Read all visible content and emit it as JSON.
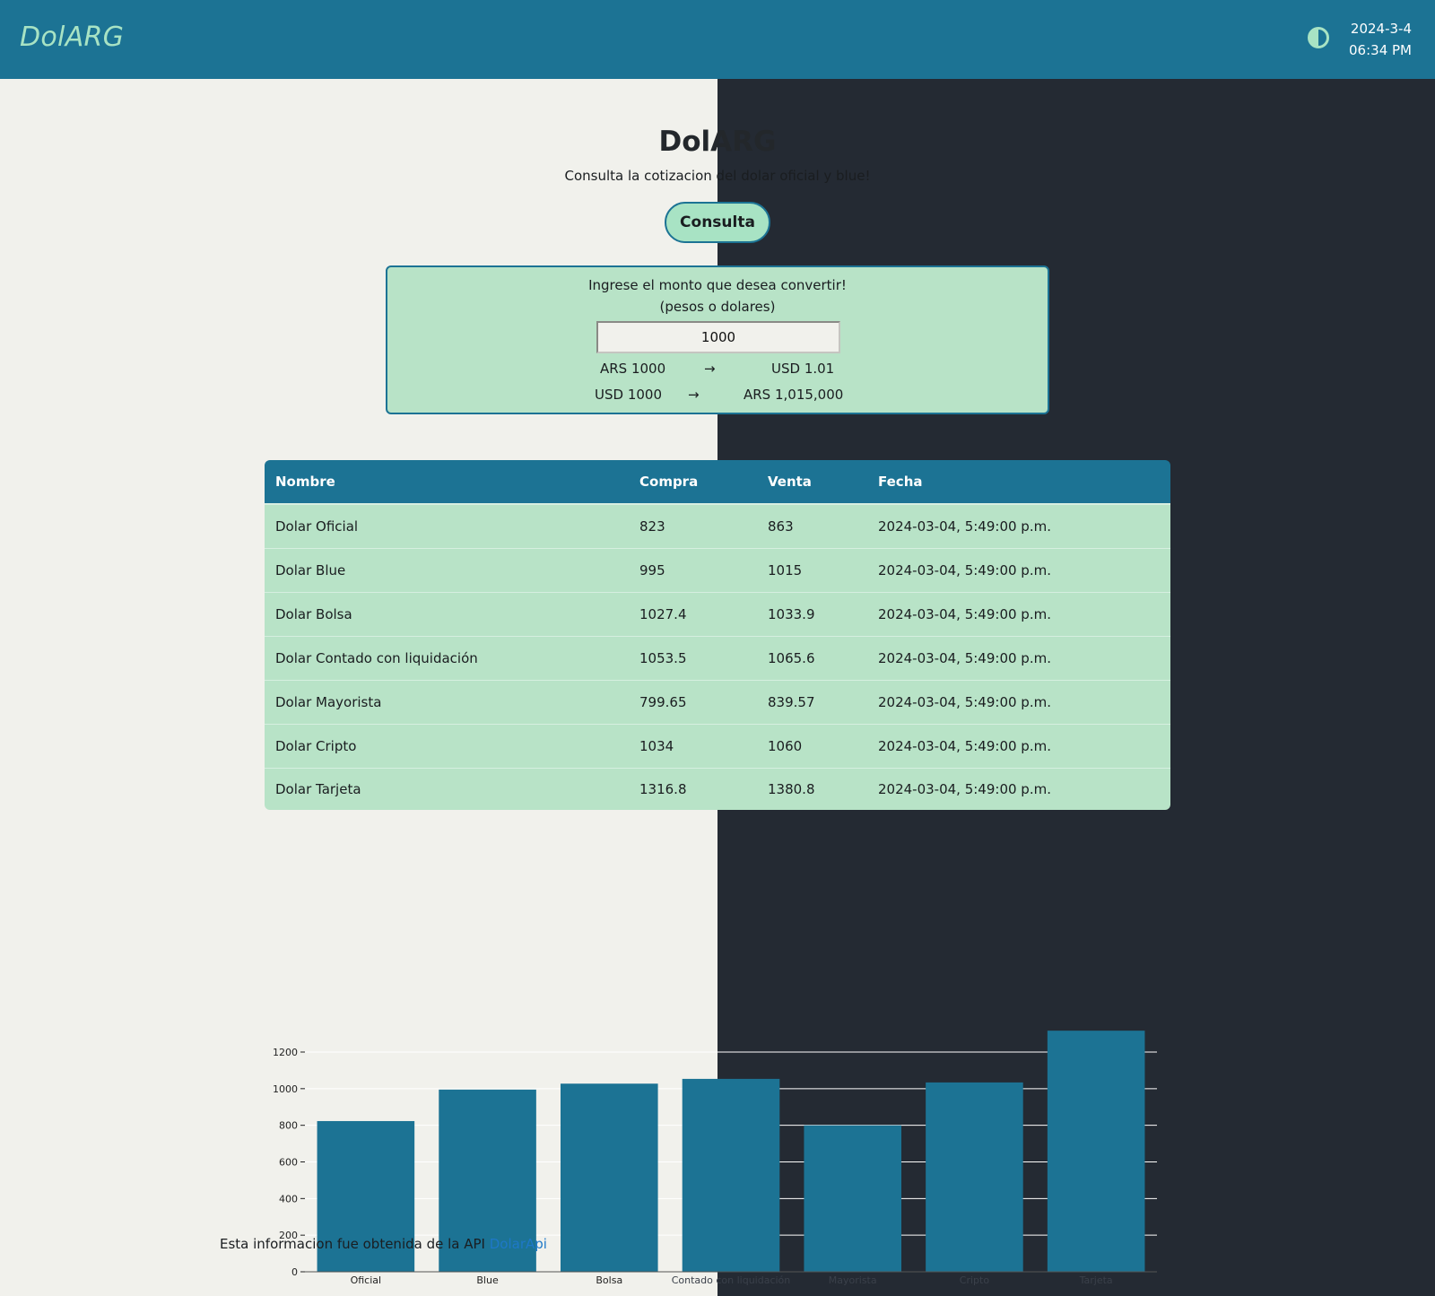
{
  "header": {
    "brand": "DolARG",
    "theme_toggle_icon": "contrast-icon",
    "date": "2024-3-4",
    "time": "06:34 PM"
  },
  "hero": {
    "title": "DolARG",
    "subtitle": "Consulta la cotizacion del dolar oficial y blue!",
    "button_label": "Consulta"
  },
  "converter": {
    "prompt_line1": "Ingrese el monto que desea convertir!",
    "prompt_line2": "(pesos o dolares)",
    "input_value": "1000",
    "rows": [
      {
        "from": "ARS 1000",
        "arrow": "→",
        "to": "USD 1.01"
      },
      {
        "from": "USD 1000",
        "arrow": "→",
        "to": "ARS 1,015,000"
      }
    ]
  },
  "table": {
    "columns": [
      "Nombre",
      "Compra",
      "Venta",
      "Fecha"
    ],
    "rows": [
      {
        "nombre": "Dolar Oficial",
        "compra": "823",
        "venta": "863",
        "fecha": "2024-03-04, 5:49:00 p.m."
      },
      {
        "nombre": "Dolar Blue",
        "compra": "995",
        "venta": "1015",
        "fecha": "2024-03-04, 5:49:00 p.m."
      },
      {
        "nombre": "Dolar Bolsa",
        "compra": "1027.4",
        "venta": "1033.9",
        "fecha": "2024-03-04, 5:49:00 p.m."
      },
      {
        "nombre": "Dolar Contado con liquidación",
        "compra": "1053.5",
        "venta": "1065.6",
        "fecha": "2024-03-04, 5:49:00 p.m."
      },
      {
        "nombre": "Dolar Mayorista",
        "compra": "799.65",
        "venta": "839.57",
        "fecha": "2024-03-04, 5:49:00 p.m."
      },
      {
        "nombre": "Dolar Cripto",
        "compra": "1034",
        "venta": "1060",
        "fecha": "2024-03-04, 5:49:00 p.m."
      },
      {
        "nombre": "Dolar Tarjeta",
        "compra": "1316.8",
        "venta": "1380.8",
        "fecha": "2024-03-04, 5:49:00 p.m."
      }
    ]
  },
  "chart_data": {
    "type": "bar",
    "categories": [
      "Oficial",
      "Blue",
      "Bolsa",
      "Contado con liquidación",
      "Mayorista",
      "Cripto",
      "Tarjeta"
    ],
    "values": [
      823,
      995,
      1027.4,
      1053.5,
      799.65,
      1034,
      1316.8
    ],
    "ylim": [
      0,
      1200
    ],
    "yticks": [
      0,
      200,
      400,
      600,
      800,
      1000,
      1200
    ],
    "grid": true,
    "bar_color": "#1c7394"
  },
  "footer": {
    "text": "Esta informacion fue obtenida de la API ",
    "link_label": "DolarApi"
  },
  "colors": {
    "header_bg": "#1c7394",
    "accent_green": "#a8e3c4",
    "light_bg": "#f1f1ec",
    "dark_bg": "#242a33"
  }
}
